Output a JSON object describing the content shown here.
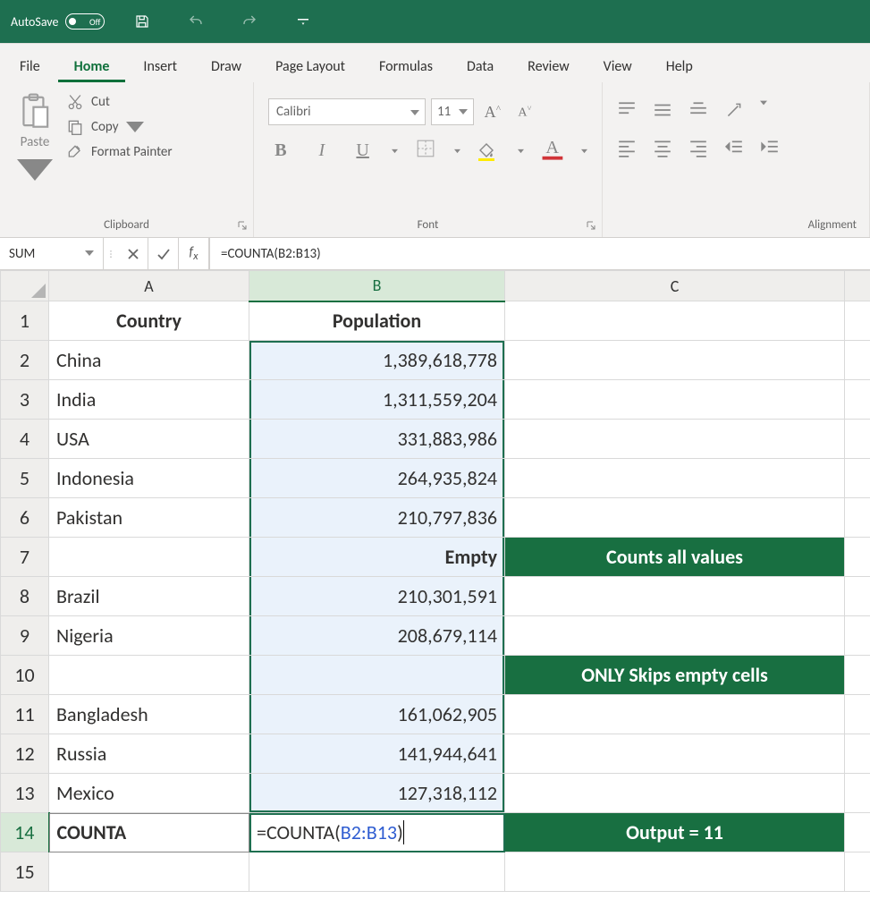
{
  "titlebar": {
    "autosave_label": "AutoSave",
    "autosave_state": "Off"
  },
  "tabs": {
    "file": "File",
    "home": "Home",
    "insert": "Insert",
    "draw": "Draw",
    "page_layout": "Page Layout",
    "formulas": "Formulas",
    "data": "Data",
    "review": "Review",
    "view": "View",
    "help": "Help"
  },
  "ribbon": {
    "clipboard": {
      "paste": "Paste",
      "cut": "Cut",
      "copy": "Copy",
      "format_painter": "Format Painter",
      "group_label": "Clipboard"
    },
    "font": {
      "font_name": "Calibri",
      "font_size": "11",
      "group_label": "Font"
    },
    "alignment": {
      "group_label": "Alignment"
    }
  },
  "formula_bar": {
    "namebox": "SUM",
    "formula": "=COUNTA(B2:B13)"
  },
  "columns": {
    "a": "A",
    "b": "B",
    "c": "C"
  },
  "rows": {
    "1": {
      "a": "Country",
      "b": "Population"
    },
    "2": {
      "a": "China",
      "b": "1,389,618,778"
    },
    "3": {
      "a": "India",
      "b": "1,311,559,204"
    },
    "4": {
      "a": "USA",
      "b": "331,883,986"
    },
    "5": {
      "a": "Indonesia",
      "b": "264,935,824"
    },
    "6": {
      "a": "Pakistan",
      "b": "210,797,836"
    },
    "7": {
      "a": "",
      "b": "Empty",
      "c": "Counts all values"
    },
    "8": {
      "a": "Brazil",
      "b": "210,301,591"
    },
    "9": {
      "a": "Nigeria",
      "b": "208,679,114"
    },
    "10": {
      "a": "",
      "b": "",
      "c": "ONLY Skips empty cells"
    },
    "11": {
      "a": "Bangladesh",
      "b": "161,062,905"
    },
    "12": {
      "a": "Russia",
      "b": "141,944,641"
    },
    "13": {
      "a": "Mexico",
      "b": "127,318,112"
    },
    "14": {
      "a": "COUNTA",
      "b_prefix": "=COUNTA(",
      "b_ref": "B2:B13",
      "b_suffix": ")",
      "c": "Output = 11"
    }
  },
  "rownums": {
    "r1": "1",
    "r2": "2",
    "r3": "3",
    "r4": "4",
    "r5": "5",
    "r6": "6",
    "r7": "7",
    "r8": "8",
    "r9": "9",
    "r10": "10",
    "r11": "11",
    "r12": "12",
    "r13": "13",
    "r14": "14",
    "r15": "15"
  }
}
